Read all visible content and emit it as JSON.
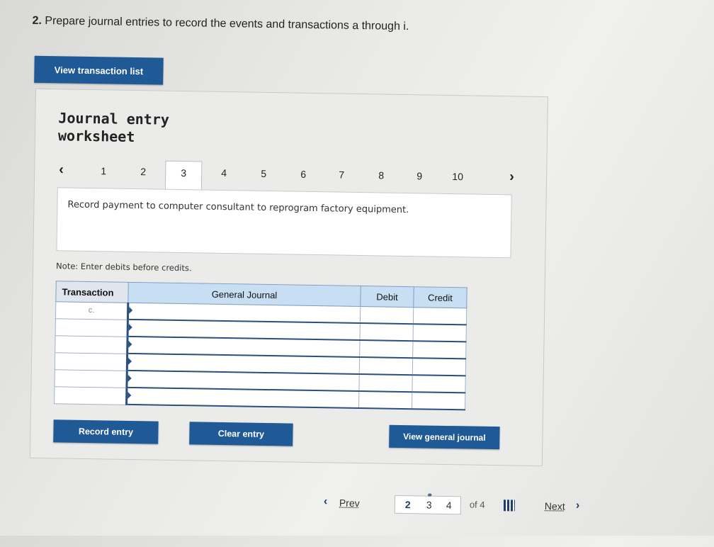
{
  "question": {
    "number": "2.",
    "text": "Prepare journal entries to record the events and transactions a through i."
  },
  "view_transaction_list": "View transaction list",
  "worksheet": {
    "title": "Journal entry worksheet",
    "tabs": [
      "1",
      "2",
      "3",
      "4",
      "5",
      "6",
      "7",
      "8",
      "9",
      "10"
    ],
    "active_tab": "3",
    "description": "Record payment to computer consultant to reprogram factory equipment.",
    "note": "Note: Enter debits before credits."
  },
  "journal_table": {
    "headers": {
      "transaction": "Transaction",
      "general_journal": "General Journal",
      "debit": "Debit",
      "credit": "Credit"
    },
    "rows": [
      {
        "transaction": "c.",
        "general_journal": "",
        "debit": "",
        "credit": ""
      },
      {
        "transaction": "",
        "general_journal": "",
        "debit": "",
        "credit": ""
      },
      {
        "transaction": "",
        "general_journal": "",
        "debit": "",
        "credit": ""
      },
      {
        "transaction": "",
        "general_journal": "",
        "debit": "",
        "credit": ""
      },
      {
        "transaction": "",
        "general_journal": "",
        "debit": "",
        "credit": ""
      },
      {
        "transaction": "",
        "general_journal": "",
        "debit": "",
        "credit": ""
      }
    ]
  },
  "buttons": {
    "record_entry": "Record entry",
    "clear_entry": "Clear entry",
    "view_general_journal": "View general journal"
  },
  "pagination": {
    "prev": "Prev",
    "pages": [
      "2",
      "3",
      "4"
    ],
    "current": "3",
    "of_total": "of 4",
    "next": "Next"
  },
  "colors": {
    "button_blue": "#1f5a96",
    "header_blue": "#c8def3"
  }
}
